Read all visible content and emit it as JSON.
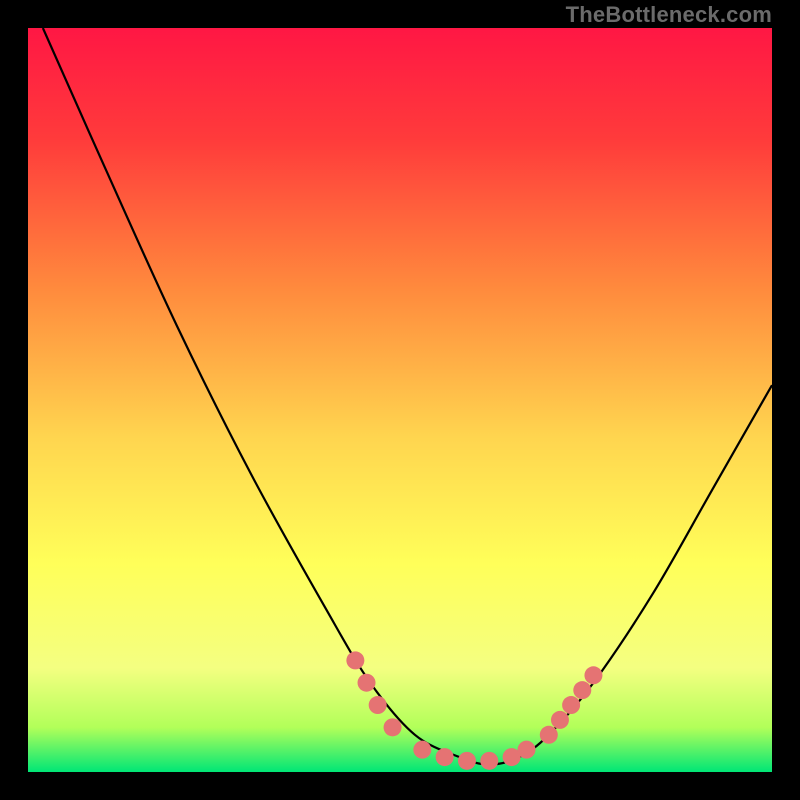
{
  "watermark": "TheBottleneck.com",
  "chart_data": {
    "type": "line",
    "title": "",
    "xlabel": "",
    "ylabel": "",
    "xlim": [
      0,
      100
    ],
    "ylim": [
      0,
      100
    ],
    "grid": false,
    "legend": false,
    "gradient_stops": [
      {
        "offset": 0.0,
        "color": "#ff1744"
      },
      {
        "offset": 0.15,
        "color": "#ff3b3b"
      },
      {
        "offset": 0.35,
        "color": "#ff8a3d"
      },
      {
        "offset": 0.55,
        "color": "#ffd54f"
      },
      {
        "offset": 0.72,
        "color": "#ffff59"
      },
      {
        "offset": 0.86,
        "color": "#f4ff81"
      },
      {
        "offset": 0.94,
        "color": "#b2ff59"
      },
      {
        "offset": 1.0,
        "color": "#00e676"
      }
    ],
    "series": [
      {
        "name": "bottleneck-curve",
        "x": [
          2,
          10,
          20,
          30,
          40,
          46,
          52,
          58,
          62,
          66,
          70,
          76,
          84,
          92,
          100
        ],
        "y": [
          100,
          82,
          60,
          40,
          22,
          12,
          5,
          2,
          1,
          2,
          5,
          12,
          24,
          38,
          52
        ]
      }
    ],
    "markers": {
      "name": "highlight-dots",
      "color": "#e57373",
      "radius": 9,
      "x": [
        44,
        45.5,
        47,
        49,
        53,
        56,
        59,
        62,
        65,
        67,
        70,
        71.5,
        73,
        74.5,
        76
      ],
      "y": [
        15,
        12,
        9,
        6,
        3,
        2,
        1.5,
        1.5,
        2,
        3,
        5,
        7,
        9,
        11,
        13
      ]
    }
  }
}
